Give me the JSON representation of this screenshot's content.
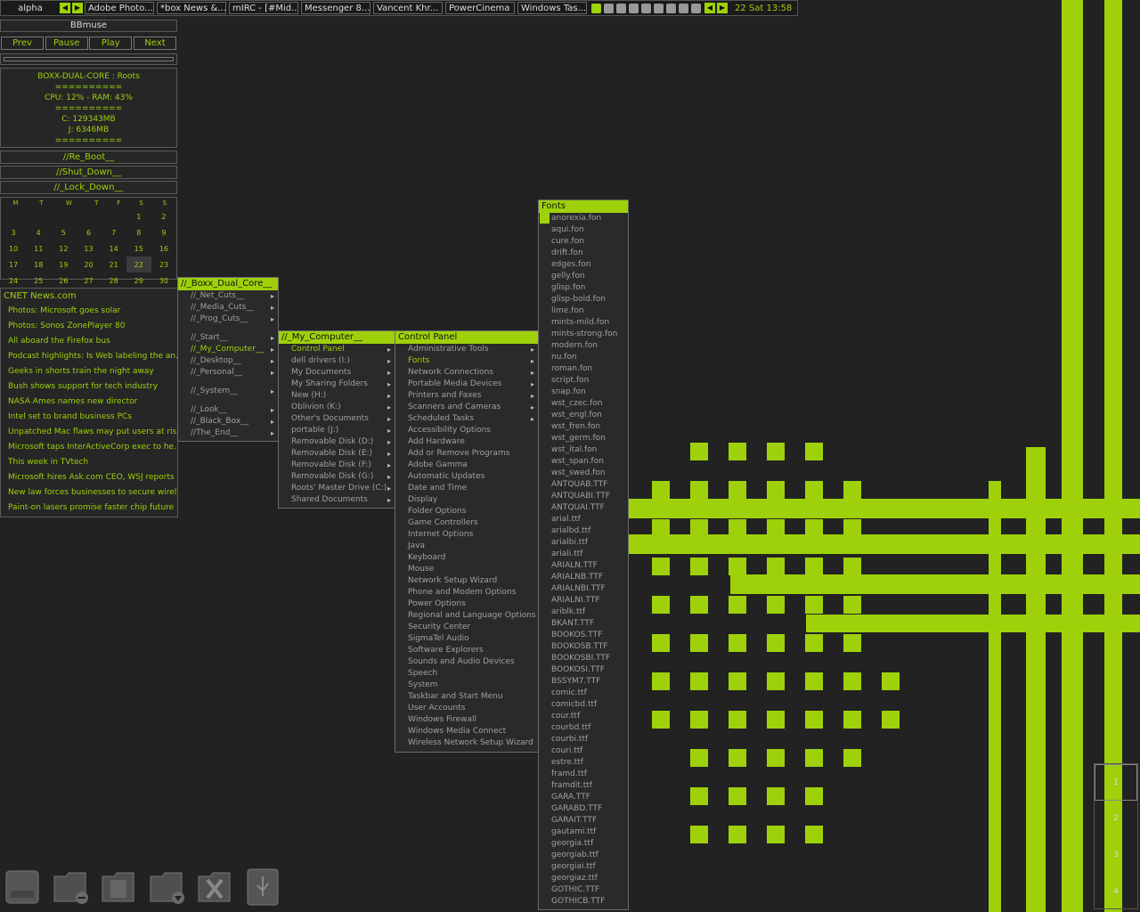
{
  "taskbar": {
    "workspace": "alpha",
    "tasks": [
      "Adobe Photo...",
      "*box News &...",
      "mIRC - [#Mid...",
      "Messenger 8...",
      "Vancent Khr...",
      "PowerCinema",
      "Windows Tas..."
    ],
    "clock": "22 Sat 13:58"
  },
  "player": {
    "title": "BBmuse",
    "prev": "Prev",
    "pause": "Pause",
    "play": "Play",
    "next": "Next"
  },
  "sysinfo": [
    "BOXX-DUAL-CORE : Roots",
    "==========",
    "CPU: 12% - RAM: 43%",
    "==========",
    "C: 129343MB",
    "J: 6346MB",
    "=========="
  ],
  "commands": {
    "reboot": "//Re_Boot__",
    "shutdown": "//Shut_Down__",
    "lockdown": "//_Lock_Down__"
  },
  "calendar": {
    "days": [
      "M",
      "T",
      "W",
      "T",
      "F",
      "S",
      "S"
    ],
    "weeks": [
      [
        "",
        "",
        "",
        "",
        "",
        "1",
        "2"
      ],
      [
        "3",
        "4",
        "5",
        "6",
        "7",
        "8",
        "9"
      ],
      [
        "10",
        "11",
        "12",
        "13",
        "14",
        "15",
        "16"
      ],
      [
        "17",
        "18",
        "19",
        "20",
        "21",
        "22",
        "23"
      ],
      [
        "24",
        "25",
        "26",
        "27",
        "28",
        "29",
        "30"
      ]
    ],
    "today": "22"
  },
  "news": {
    "title": "CNET News.com",
    "items": [
      "Photos: Microsoft goes solar",
      "Photos: Sonos ZonePlayer 80",
      "All aboard the Firefox bus",
      "Podcast highlights: Is Web labeling the an...",
      "Geeks in shorts train the night away",
      "Bush shows support for tech industry",
      "NASA Ames names new director",
      "Intel set to brand business PCs",
      "Unpatched Mac flaws may put users at risk",
      "Microsoft taps InterActiveCorp exec to he...",
      "This week in TVtech",
      "Microsoft hires Ask.com CEO, WSJ reports",
      "New law forces businesses to secure wirel...",
      "Paint-on lasers promise faster chip future"
    ]
  },
  "root_menu": {
    "title": "//_Boxx_Dual_Core__",
    "groups": [
      [
        "//_Net_Cuts__",
        "//_Media_Cuts__",
        "//_Prog_Cuts__"
      ],
      [
        "//_Start__",
        "//_My_Computer__",
        "//_Desktop__",
        "//_Personal__"
      ],
      [
        "//_System__"
      ],
      [
        "//_Look__",
        "//_Black_Box__",
        "//The_End__"
      ]
    ]
  },
  "computer_menu": {
    "title": "//_My_Computer__",
    "items": [
      "Control Panel",
      "dell drivers (I:)",
      "My Documents",
      "My Sharing Folders",
      "New (H:)",
      "Oblivion (K:)",
      "Other's Documents",
      "portable (J:)",
      "Removable Disk (D:)",
      "Removable Disk (E:)",
      "Removable Disk (F:)",
      "Removable Disk (G:)",
      "Roots' Master Drive (C:)",
      "Shared Documents"
    ]
  },
  "control_menu": {
    "title": "Control Panel",
    "items": [
      "Administrative Tools",
      "Fonts",
      "Network Connections",
      "Portable Media Devices",
      "Printers and Faxes",
      "Scanners and Cameras",
      "Scheduled Tasks",
      "Accessibility Options",
      "Add Hardware",
      "Add or Remove Programs",
      "Adobe Gamma",
      "Automatic Updates",
      "Date and Time",
      "Display",
      "Folder Options",
      "Game Controllers",
      "Internet Options",
      "Java",
      "Keyboard",
      "Mouse",
      "Network Setup Wizard",
      "Phone and Modem Options",
      "Power Options",
      "Regional and Language Options",
      "Security Center",
      "SigmaTel Audio",
      "Software Explorers",
      "Sounds and Audio Devices",
      "Speech",
      "System",
      "Taskbar and Start Menu",
      "User Accounts",
      "Windows Firewall",
      "Windows Media Connect",
      "Wireless Network Setup Wizard"
    ]
  },
  "fonts_menu": {
    "title": "Fonts",
    "items": [
      "anorexia.fon",
      "aqui.fon",
      "cure.fon",
      "drift.fon",
      "edges.fon",
      "gelly.fon",
      "glisp.fon",
      "glisp-bold.fon",
      "lime.fon",
      "mints-mild.fon",
      "mints-strong.fon",
      "modern.fon",
      "nu.fon",
      "roman.fon",
      "script.fon",
      "snap.fon",
      "wst_czec.fon",
      "wst_engl.fon",
      "wst_fren.fon",
      "wst_germ.fon",
      "wst_ital.fon",
      "wst_span.fon",
      "wst_swed.fon",
      "ANTQUAB.TTF",
      "ANTQUABI.TTF",
      "ANTQUAI.TTF",
      "arial.ttf",
      "arialbd.ttf",
      "arialbi.ttf",
      "ariali.ttf",
      "ARIALN.TTF",
      "ARIALNB.TTF",
      "ARIALNBI.TTF",
      "ARIALNI.TTF",
      "ariblk.ttf",
      "BKANT.TTF",
      "BOOKOS.TTF",
      "BOOKOSB.TTF",
      "BOOKOSBI.TTF",
      "BOOKOSI.TTF",
      "BSSYM7.TTF",
      "comic.ttf",
      "comicbd.ttf",
      "cour.ttf",
      "courbd.ttf",
      "courbi.ttf",
      "couri.ttf",
      "estre.ttf",
      "framd.ttf",
      "framdit.ttf",
      "GARA.TTF",
      "GARABD.TTF",
      "GARAIT.TTF",
      "gautami.ttf",
      "georgia.ttf",
      "georgiab.ttf",
      "georgiai.ttf",
      "georgiaz.ttf",
      "GOTHIC.TTF",
      "GOTHICB.TTF"
    ]
  },
  "pager": [
    "1",
    "2",
    "3",
    "4"
  ],
  "dock_icons": [
    "drive-icon",
    "folder-remove-icon",
    "documents-icon",
    "folder-download-icon",
    "close-x-icon",
    "usb-icon"
  ],
  "colors": {
    "accent": "#9ed10a",
    "background": "#222222",
    "menu_bg": "#2a2a2a"
  }
}
